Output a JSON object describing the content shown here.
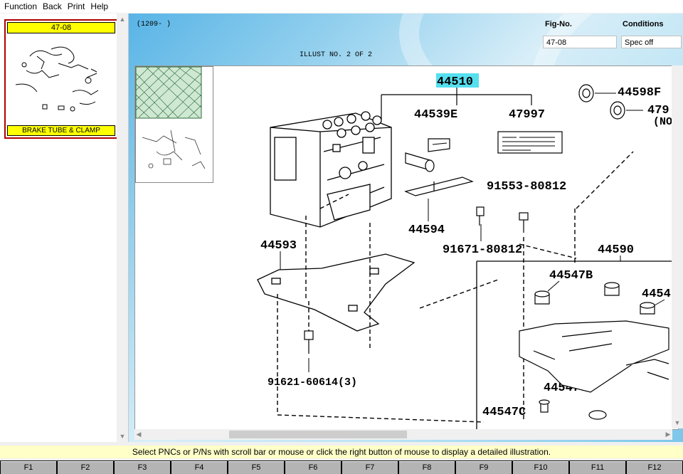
{
  "menu": {
    "items": [
      "Function",
      "Back",
      "Print",
      "Help"
    ]
  },
  "thumbnail": {
    "fig_no": "47-08",
    "caption": "BRAKE TUBE & CLAMP"
  },
  "header": {
    "date_range": "(1209-     )",
    "illust_label": "ILLUST NO. 2 OF 2",
    "fig_no_label": "Fig-No.",
    "fig_no_value": "47-08",
    "conditions_label": "Conditions",
    "conditions_value": "Spec off"
  },
  "parts": {
    "p44510": "44510",
    "p44539E": "44539E",
    "p47997": "47997",
    "p44598F": "44598F",
    "p479": "479",
    "p_no": "(NO",
    "p91553": "91553-80812",
    "p44594": "44594",
    "p91671": "91671-80812",
    "p44593": "44593",
    "p44590": "44590",
    "p44547B": "44547B",
    "p4454": "4454",
    "p91621": "91621-60614(3)",
    "p44547C_a": "44547C",
    "p44547C_b": "44547C"
  },
  "status_message": "Select PNCs or P/Ns with scroll bar or mouse or click the right button of mouse to display a detailed illustration.",
  "fkeys": [
    "F1",
    "F2",
    "F3",
    "F4",
    "F5",
    "F6",
    "F7",
    "F8",
    "F9",
    "F10",
    "F11",
    "F12"
  ],
  "colors": {
    "highlight": "#55e0f0",
    "thumb_header": "#ffff00",
    "thumb_border": "#b00000",
    "status_bg": "#ffffc8"
  }
}
